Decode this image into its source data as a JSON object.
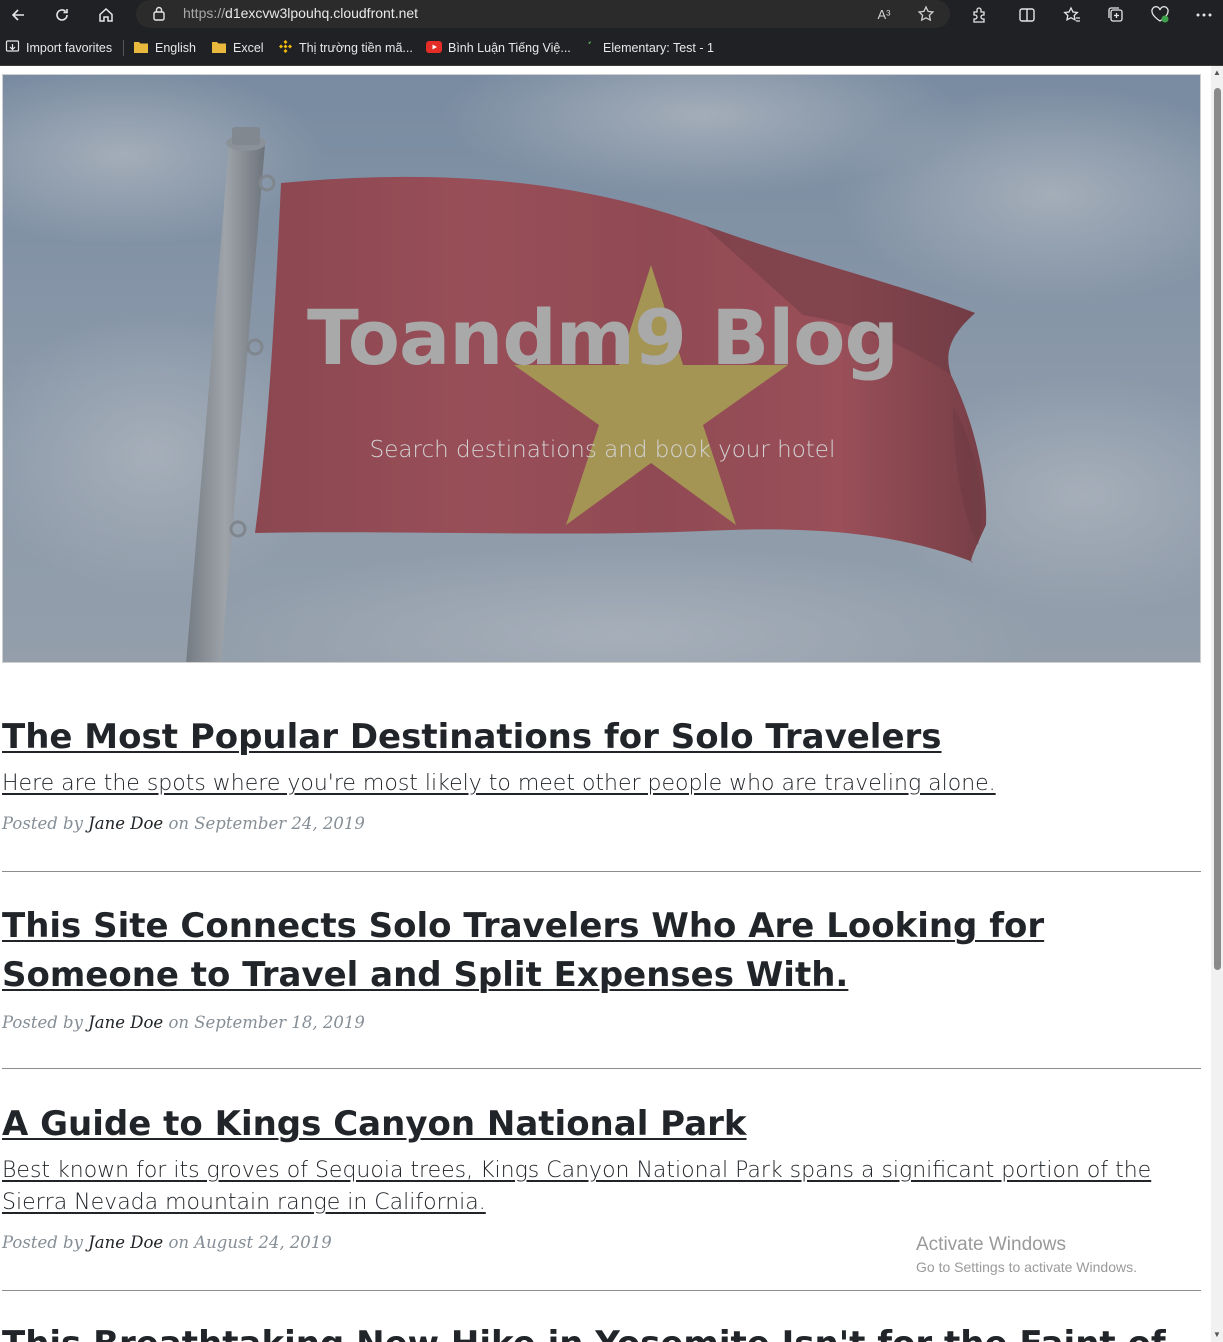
{
  "browser": {
    "url_scheme": "https://",
    "url_host": "d1excvw3lpouhq.cloudfront.net",
    "read_aloud_label": "A³"
  },
  "bookmarks": [
    {
      "label": "Import favorites",
      "icon": "import-icon"
    },
    {
      "label": "English",
      "icon": "folder-icon"
    },
    {
      "label": "Excel",
      "icon": "folder-icon"
    },
    {
      "label": "Thị trường tiền mã...",
      "icon": "binance-icon"
    },
    {
      "label": "Bình Luận Tiếng Việ...",
      "icon": "youtube-icon"
    },
    {
      "label": "Elementary: Test - 1",
      "icon": "site-icon"
    }
  ],
  "hero": {
    "title": "Toandm9 Blog",
    "subtitle": "Search destinations and book your hotel"
  },
  "posts": [
    {
      "title": "The Most Popular Destinations for Solo Travelers",
      "subtitle": "Here are the spots where you're most likely to meet other people who are traveling alone.",
      "meta_prefix": "Posted by",
      "author": "Jane Doe",
      "meta_on": "on September 24, 2019"
    },
    {
      "title": "This Site Connects Solo Travelers Who Are Looking for Someone to Travel and Split Expenses With.",
      "subtitle": "",
      "meta_prefix": "Posted by",
      "author": "Jane Doe",
      "meta_on": "on September 18, 2019"
    },
    {
      "title": "A Guide to Kings Canyon National Park",
      "subtitle": "Best known for its groves of Sequoia trees, Kings Canyon National Park spans a significant portion of the Sierra Nevada mountain range in California.",
      "meta_prefix": "Posted by",
      "author": "Jane Doe",
      "meta_on": "on August 24, 2019"
    },
    {
      "title": "This Breathtaking New Hike in Yosemite Isn't for the Faint of"
    }
  ],
  "watermark": {
    "line1": "Activate Windows",
    "line2": "Go to Settings to activate Windows."
  },
  "colors": {
    "flag_red": "#b2363f",
    "flag_star": "#c9b443",
    "sky": "#8fa4bd",
    "text_dark": "#212529",
    "meta_gray": "#868e96"
  }
}
